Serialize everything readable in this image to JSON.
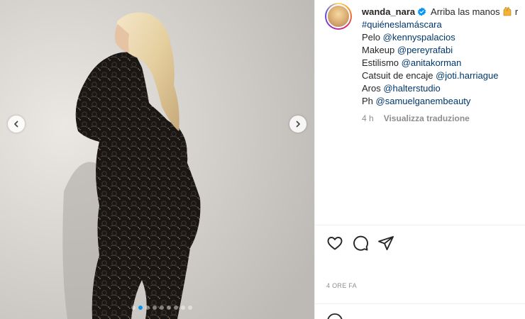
{
  "post": {
    "media": {
      "alt": "",
      "carousel_count": 9,
      "active_index": 1,
      "accent_color": "#0095f6"
    },
    "author": {
      "username": "wanda_nara",
      "verified": true,
      "verified_color": "#0095f6"
    },
    "caption": {
      "first_line": "Arriba las manos",
      "first_line_emoji": "raising-hands-emoji",
      "first_line_trailing": "r",
      "hashtag": "#quiéneslamáscara",
      "credits": [
        {
          "label": "Pelo",
          "handle": "@kennyspalacios"
        },
        {
          "label": "Makeup",
          "handle": "@pereyrafabi"
        },
        {
          "label": "Estilismo",
          "handle": "@anitakorman"
        },
        {
          "label": "Catsuit de encaje",
          "handle": "@joti.harriague"
        },
        {
          "label": "Aros",
          "handle": "@halterstudio"
        },
        {
          "label": "Ph",
          "handle": "@samuelganembeauty"
        }
      ],
      "age": "4 h",
      "translate_label": "Visualizza traduzione"
    },
    "actions": {
      "like_icon": "heart-icon",
      "comment_icon": "comment-icon",
      "share_icon": "share-icon"
    },
    "timestamp": "4 ORE FA",
    "comment_placeholder": ""
  }
}
